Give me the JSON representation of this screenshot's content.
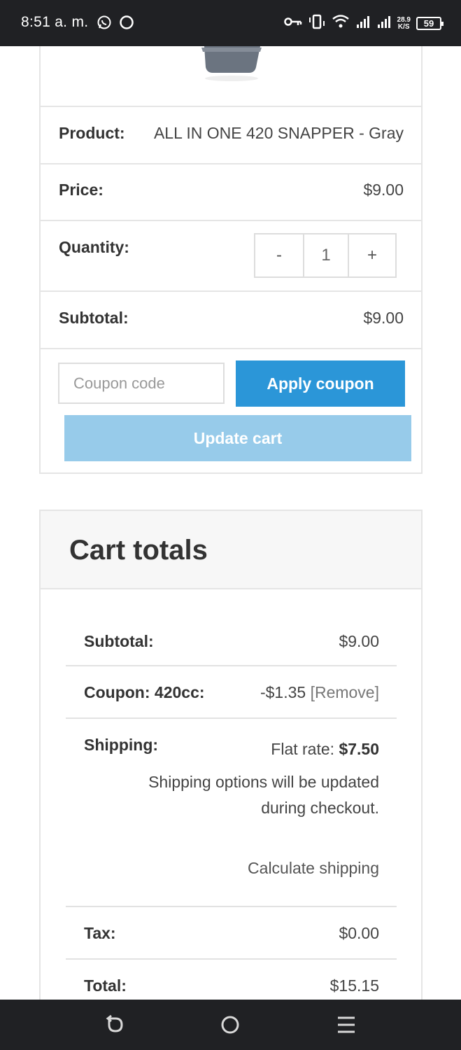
{
  "status_bar": {
    "time": "8:51 a. m.",
    "network_speed_value": "28.9",
    "network_speed_unit": "K/S",
    "battery": "59",
    "icons": [
      "whatsapp-icon",
      "sync-icon",
      "key-icon",
      "vibrate-icon",
      "wifi-icon",
      "signal-icon",
      "signal-icon-2"
    ]
  },
  "cart": {
    "product_label": "Product:",
    "product_value": "ALL IN ONE 420 SNAPPER - Gray",
    "price_label": "Price:",
    "price_value": "$9.00",
    "quantity_label": "Quantity:",
    "quantity_minus": "-",
    "quantity_value": "1",
    "quantity_plus": "+",
    "subtotal_label": "Subtotal:",
    "subtotal_value": "$9.00",
    "coupon_placeholder": "Coupon code",
    "apply_coupon_label": "Apply coupon",
    "update_cart_label": "Update cart"
  },
  "totals": {
    "title": "Cart totals",
    "subtotal_label": "Subtotal:",
    "subtotal_value": "$9.00",
    "coupon_label": "Coupon: 420cc:",
    "coupon_value": "-$1.35",
    "coupon_remove": "[Remove]",
    "shipping_label": "Shipping:",
    "shipping_rate_label": "Flat rate: ",
    "shipping_rate_value": "$7.50",
    "shipping_note": "Shipping options will be updated during checkout.",
    "calculate_shipping": "Calculate shipping",
    "tax_label": "Tax:",
    "tax_value": "$0.00",
    "total_label": "Total:",
    "total_value": "$15.15"
  },
  "colors": {
    "apply_button": "#2b96d8",
    "update_button": "#97cbea",
    "system_bars": "#202124"
  }
}
